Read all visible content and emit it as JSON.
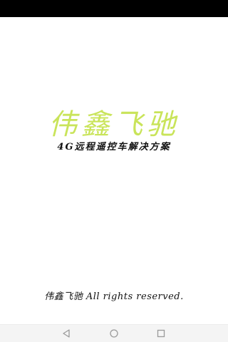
{
  "app": {
    "title": "伟鑫飞驰",
    "subtitle": "4G远程遥控车解决方案",
    "copyright": "伟鑫飞驰 All rights reserved."
  },
  "colors": {
    "title": "#c9e45a",
    "text": "#111111",
    "status_bar": "#000000",
    "nav_bar": "#f4f4f4",
    "nav_icon": "#9a9a9a"
  },
  "nav": {
    "back_icon": "back-triangle-icon",
    "home_icon": "home-circle-icon",
    "recent_icon": "recent-square-icon"
  }
}
